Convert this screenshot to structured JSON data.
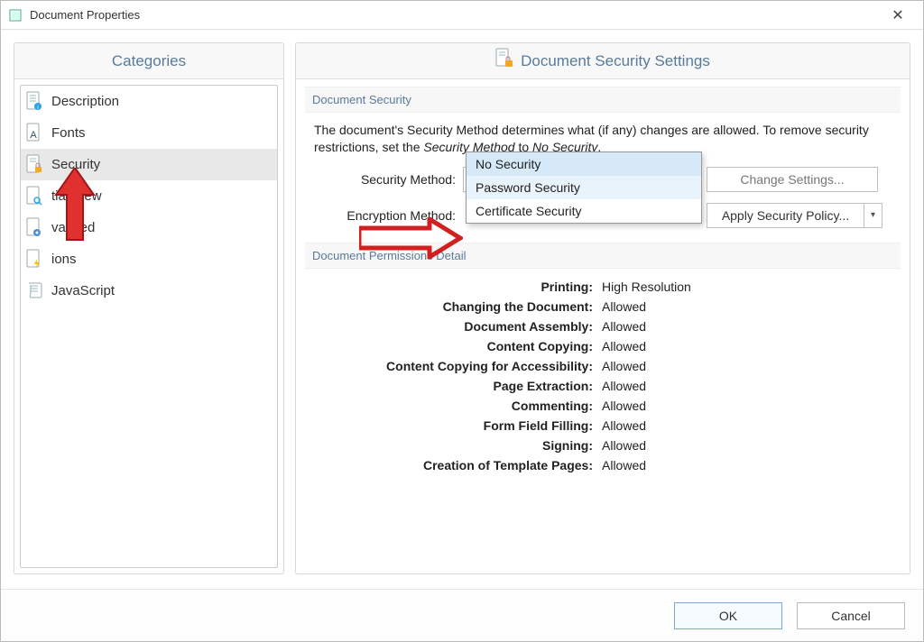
{
  "window": {
    "title": "Document Properties"
  },
  "categories": {
    "header": "Categories",
    "items": [
      {
        "label": "Description",
        "badge": "info"
      },
      {
        "label": "Fonts"
      },
      {
        "label": "Security",
        "selected": true
      },
      {
        "label": "tial View",
        "obscured": true
      },
      {
        "label": "vanced",
        "obscured": true
      },
      {
        "label": "ions",
        "obscured": true
      },
      {
        "label": "JavaScript"
      }
    ]
  },
  "settings": {
    "header": "Document Security Settings",
    "doc_security_group": "Document Security",
    "description_prefix": "The document's Security Method determines what (if any) changes are allowed. To remove security restrictions, set the ",
    "description_em1": "Security Method",
    "description_mid": " to ",
    "description_em2": "No Security",
    "description_suffix": ".",
    "security_method_label": "Security Method:",
    "security_method_value": "No Security",
    "change_settings_btn": "Change Settings...",
    "encryption_label": "Encryption Method:",
    "apply_policy_btn": "Apply Security Policy...",
    "dropdown_options": [
      "No Security",
      "Password Security",
      "Certificate Security"
    ],
    "permissions_group": "Document Permissions Detail",
    "permissions": [
      {
        "k": "Printing:",
        "v": "High Resolution"
      },
      {
        "k": "Changing the Document:",
        "v": "Allowed"
      },
      {
        "k": "Document Assembly:",
        "v": "Allowed"
      },
      {
        "k": "Content Copying:",
        "v": "Allowed"
      },
      {
        "k": "Content Copying for Accessibility:",
        "v": "Allowed"
      },
      {
        "k": "Page Extraction:",
        "v": "Allowed"
      },
      {
        "k": "Commenting:",
        "v": "Allowed"
      },
      {
        "k": "Form Field Filling:",
        "v": "Allowed"
      },
      {
        "k": "Signing:",
        "v": "Allowed"
      },
      {
        "k": "Creation of Template Pages:",
        "v": "Allowed"
      }
    ]
  },
  "footer": {
    "ok": "OK",
    "cancel": "Cancel"
  }
}
